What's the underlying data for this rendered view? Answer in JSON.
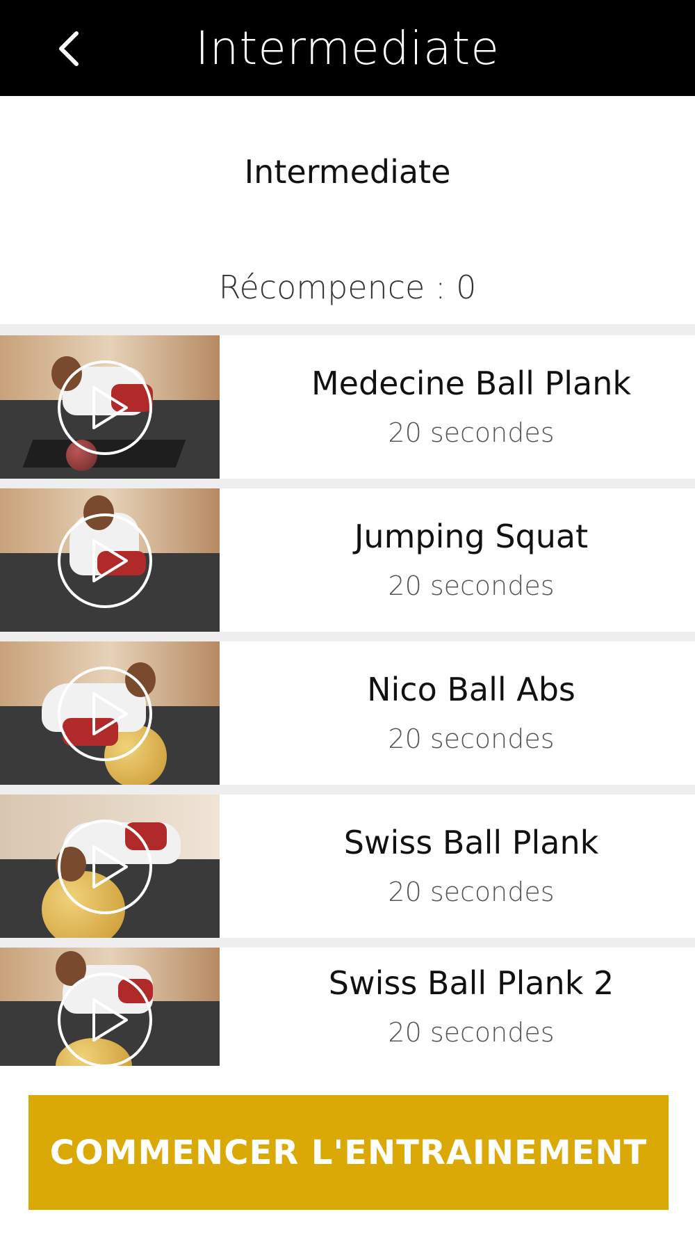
{
  "header": {
    "title": "Intermediate",
    "back_icon": "chevron-left-icon"
  },
  "program": {
    "name": "Intermediate",
    "reward_text": "Récompence : 0"
  },
  "exercises": [
    {
      "name": "Medecine Ball Plank",
      "duration": "20 secondes"
    },
    {
      "name": "Jumping Squat",
      "duration": "20 secondes"
    },
    {
      "name": "Nico Ball Abs",
      "duration": "20 secondes"
    },
    {
      "name": "Swiss Ball Plank",
      "duration": "20 secondes"
    },
    {
      "name": "Swiss Ball Plank 2",
      "duration": "20 secondes"
    }
  ],
  "cta": {
    "label": "COMMENCER L'ENTRAINEMENT",
    "color": "#dba905"
  },
  "colors": {
    "header_bg": "#000000",
    "list_divider": "#eeeeee"
  }
}
